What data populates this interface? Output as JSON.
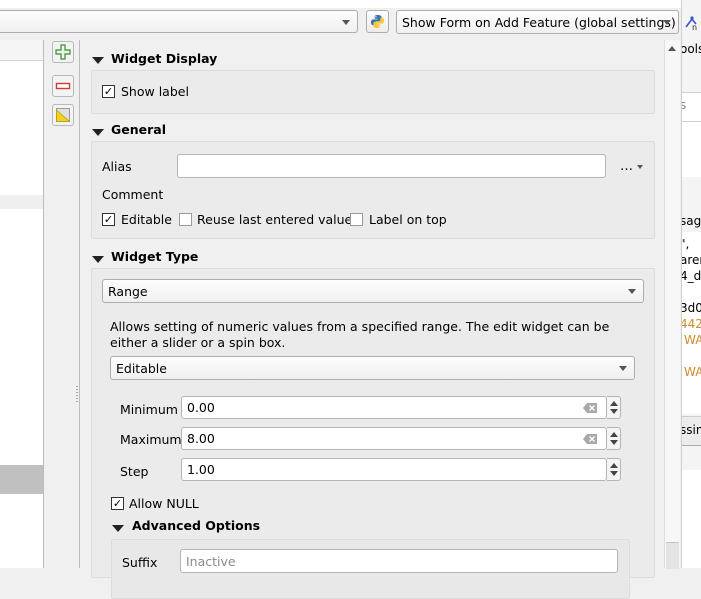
{
  "toolbar": {
    "layer_combo_value": "",
    "python_button_icon": "python-icon",
    "form_suppress_combo_value": "Show Form on Add Feature (global settings)"
  },
  "side_tools": [
    {
      "name": "add-field-button",
      "icon": "plus-icon"
    },
    {
      "name": "remove-field-button",
      "icon": "minus-icon"
    },
    {
      "name": "field-calculator-button",
      "icon": "field-calculator-icon"
    }
  ],
  "widget_display": {
    "title": "Widget Display",
    "show_label": {
      "label": "Show label",
      "checked": true
    }
  },
  "general": {
    "title": "General",
    "alias_label": "Alias",
    "alias_value": "",
    "alias_menu": "…",
    "comment_label": "Comment",
    "editable": {
      "label": "Editable",
      "checked": true
    },
    "reuse_last": {
      "label": "Reuse last entered value",
      "checked": false
    },
    "label_on_top": {
      "label": "Label on top",
      "checked": false
    }
  },
  "widget_type": {
    "title": "Widget Type",
    "type_value": "Range",
    "description": "Allows setting of numeric values from a specified range. The edit widget can be either a slider or a spin box.",
    "mode_value": "Editable",
    "minimum_label": "Minimum",
    "minimum_value": "0.00",
    "maximum_label": "Maximum",
    "maximum_value": "8.00",
    "step_label": "Step",
    "step_value": "1.00",
    "allow_null": {
      "label": "Allow NULL",
      "checked": true
    },
    "advanced": {
      "title": "Advanced Options",
      "suffix_label": "Suffix",
      "suffix_placeholder": "Inactive"
    }
  },
  "right_panel": {
    "fragments": [
      "ools",
      "s",
      "sag",
      "\",",
      "aren",
      "4_dl",
      "3d0",
      "442",
      "WA",
      "WA",
      "ssin"
    ]
  },
  "check_mark": "✓"
}
